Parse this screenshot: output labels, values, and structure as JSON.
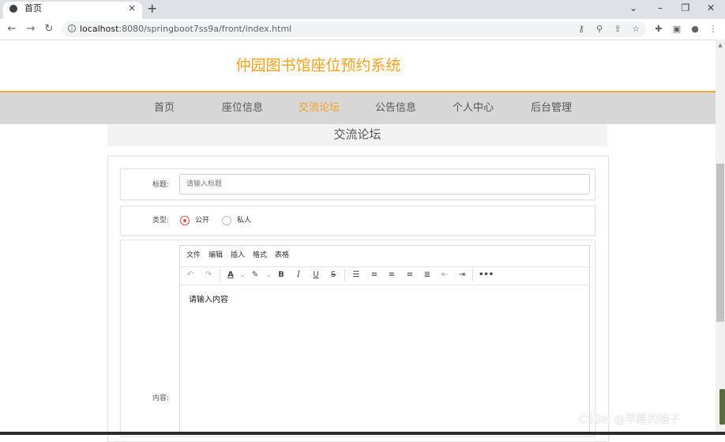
{
  "browser": {
    "tab_title": "首页",
    "tab_close": "×",
    "new_tab": "+",
    "url_host": "localhost",
    "url_rest": ":8080/springboot7ss9a/front/index.html",
    "window_controls": [
      "⌄",
      "–",
      "❐",
      "✕"
    ],
    "nav_controls": [
      "←",
      "→",
      "↻"
    ],
    "toolbar_icons": [
      "key-icon",
      "zoom-icon",
      "share-icon",
      "star-icon",
      "extensions-icon",
      "sidepanel-icon",
      "profile-icon",
      "menu-icon"
    ]
  },
  "header": {
    "title": "仲园图书馆座位预约系统"
  },
  "nav": {
    "items": [
      "首页",
      "座位信息",
      "交流论坛",
      "公告信息",
      "个人中心",
      "后台管理"
    ],
    "active_index": 2,
    "accent": "#f5a11c"
  },
  "section": {
    "title": "交流论坛"
  },
  "form": {
    "title_label": "标题:",
    "title_placeholder": "请输入标题",
    "type_label": "类型:",
    "type_options": [
      "公开",
      "私人"
    ],
    "type_selected": "公开",
    "content_label": "内容:",
    "editor": {
      "menubar": [
        "文件",
        "编辑",
        "插入",
        "格式",
        "表格"
      ],
      "placeholder": "请输入内容"
    }
  },
  "watermark": "CSDN @早睡的柚子"
}
